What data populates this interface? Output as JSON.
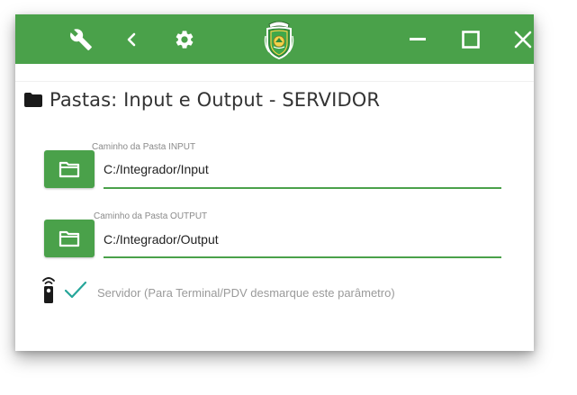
{
  "titlebar": {
    "color": "#4aa14a",
    "icons": {
      "tools": "wrench-icon",
      "back": "chevron-left-icon",
      "settings": "gear-icon",
      "emblem": "state-emblem-icon",
      "minimize": "minimize-icon",
      "maximize": "maximize-icon",
      "close": "close-icon"
    }
  },
  "section": {
    "icon": "folder-icon",
    "title": "Pastas: Input e Output - SERVIDOR"
  },
  "input_folder": {
    "label": "Caminho da Pasta INPUT",
    "value": "C:/Integrador/Input",
    "button_icon": "folder-open-icon"
  },
  "output_folder": {
    "label": "Caminho da Pasta OUTPUT",
    "value": "C:/Integrador/Output",
    "button_icon": "folder-open-icon"
  },
  "server_option": {
    "icon": "remote-control-icon",
    "checked": true,
    "check_color": "#26a69a",
    "label": "Servidor (Para Terminal/PDV desmarque este parâmetro)"
  }
}
